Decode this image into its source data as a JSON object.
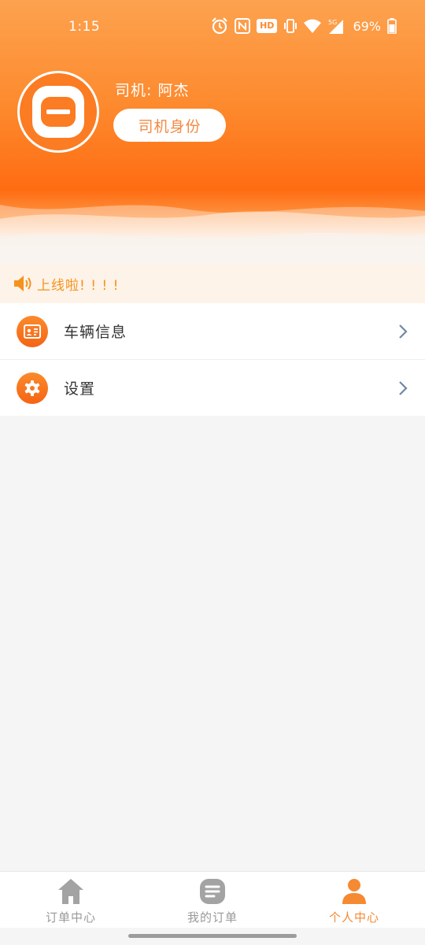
{
  "status_bar": {
    "time": "1:15",
    "hd_label": "HD",
    "network_label": "5G",
    "battery": "69%"
  },
  "profile": {
    "driver_label": "司机: 阿杰",
    "identity_button": "司机身份"
  },
  "notice": {
    "text": "上线啦! ! ! !"
  },
  "menu": {
    "items": [
      {
        "label": "车辆信息",
        "icon": "vehicle-card-icon"
      },
      {
        "label": "设置",
        "icon": "gear-icon"
      }
    ]
  },
  "bottom_nav": {
    "items": [
      {
        "label": "订单中心",
        "icon": "home-icon"
      },
      {
        "label": "我的订单",
        "icon": "list-icon"
      },
      {
        "label": "个人中心",
        "icon": "person-icon",
        "active": true
      }
    ]
  },
  "colors": {
    "accent": "#fb7c22",
    "notice_text": "#f5921e",
    "active_nav": "#f58a33"
  }
}
